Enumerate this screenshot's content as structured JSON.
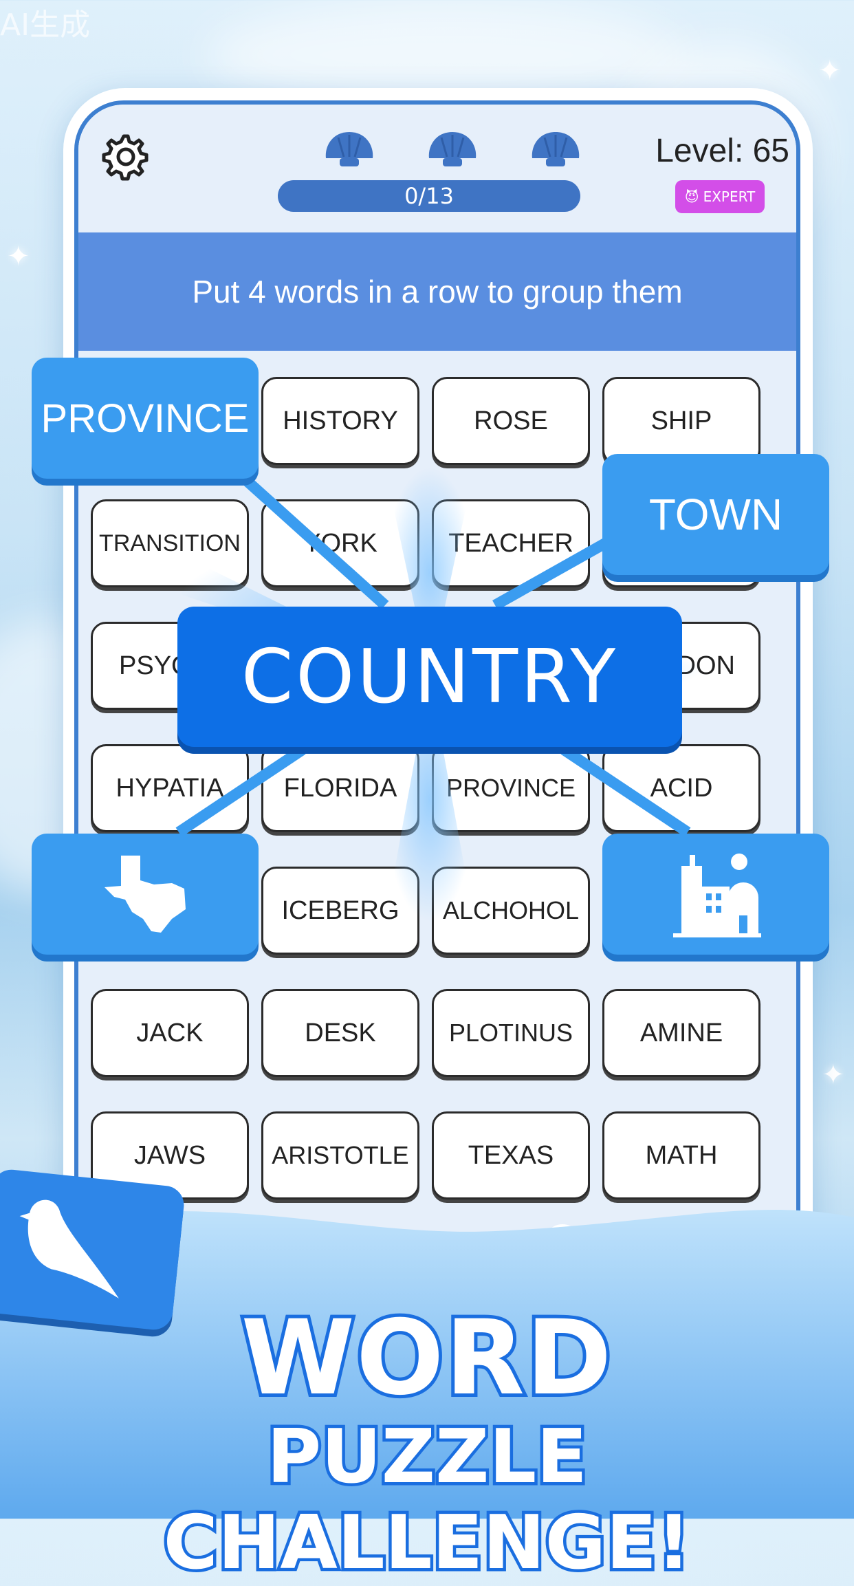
{
  "watermark": "AI生成",
  "header": {
    "progress": "0/13",
    "level": "Level: 65",
    "difficulty_badge": "EXPERT",
    "shells": [
      "shell-icon",
      "shell-icon",
      "shell-icon"
    ]
  },
  "instruction": "Put 4 words in a row to group them",
  "grid": {
    "rows": [
      [
        "",
        "HISTORY",
        "ROSE",
        "SHIP"
      ],
      [
        "TRANSITION",
        "YORK",
        "TEACHER",
        ""
      ],
      [
        "PSYC",
        "",
        "",
        "DON"
      ],
      [
        "HYPATIA",
        "FLORIDA",
        "PROVINCE",
        "ACID"
      ],
      [
        "",
        "ICEBERG",
        "ALCHOHOL",
        ""
      ],
      [
        "JACK",
        "DESK",
        "PLOTINUS",
        "AMINE"
      ],
      [
        "JAWS",
        "ARISTOTLE",
        "TEXAS",
        "MATH"
      ]
    ]
  },
  "category": {
    "center": "COUNTRY",
    "top_left": "PROVINCE",
    "top_right": "TOWN",
    "bottom_left_icon": "texas-map-icon",
    "bottom_right_icon": "city-buildings-icon"
  },
  "promo": {
    "title_line1": "WORD",
    "title_line2": "PUZZLE CHALLENGE!",
    "bird_icon": "bird-icon"
  },
  "colors": {
    "accent": "#0d6fe6",
    "tile_blue": "#3a9cf0",
    "banner": "#5a8ee0",
    "badge": "#d34ee8"
  }
}
